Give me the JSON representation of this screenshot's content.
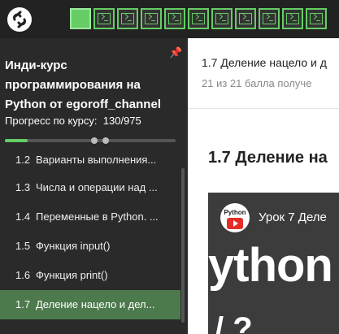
{
  "topbar": {
    "logo_icon": "stepik-logo-icon",
    "steps": [
      {
        "state": "active",
        "icon": "step-active"
      },
      {
        "state": "done",
        "icon": "code-step-icon"
      },
      {
        "state": "done",
        "icon": "code-step-icon"
      },
      {
        "state": "done",
        "icon": "code-step-icon"
      },
      {
        "state": "done",
        "icon": "code-step-icon"
      },
      {
        "state": "done",
        "icon": "code-step-icon"
      },
      {
        "state": "done",
        "icon": "code-step-icon"
      },
      {
        "state": "done",
        "icon": "code-step-icon"
      },
      {
        "state": "done",
        "icon": "code-step-icon"
      },
      {
        "state": "done",
        "icon": "code-step-icon"
      },
      {
        "state": "done",
        "icon": "code-step-icon"
      }
    ],
    "colors": {
      "bg": "#222222",
      "step_done": "#66cc66"
    }
  },
  "sidebar": {
    "course_title": "Инди-курс программирования на Python от egoroff_channel",
    "progress_label": "Прогресс по курсу:",
    "progress_value": "130/975",
    "progress_fraction": 0.133,
    "pin_icon": "pin-icon",
    "lessons": [
      {
        "num": "1.2",
        "title": "Варианты выполнения..."
      },
      {
        "num": "1.3",
        "title": "Числа и операции над ..."
      },
      {
        "num": "1.4",
        "title": "Переменные в Python. ..."
      },
      {
        "num": "1.5",
        "title": "Функция input()"
      },
      {
        "num": "1.6",
        "title": "Функция print()"
      },
      {
        "num": "1.7",
        "title": "Деление нацело и дел..."
      }
    ],
    "active_lesson_index": 5
  },
  "main": {
    "header_title": "1.7 Деление нацело и д",
    "score": "21 из 21 балла  получе",
    "lesson_heading": "1.7 Деление на",
    "video": {
      "channel_label": "Python",
      "title": "Урок 7 Деле",
      "big_text": "ython",
      "big_text_2": "/ ?"
    }
  }
}
